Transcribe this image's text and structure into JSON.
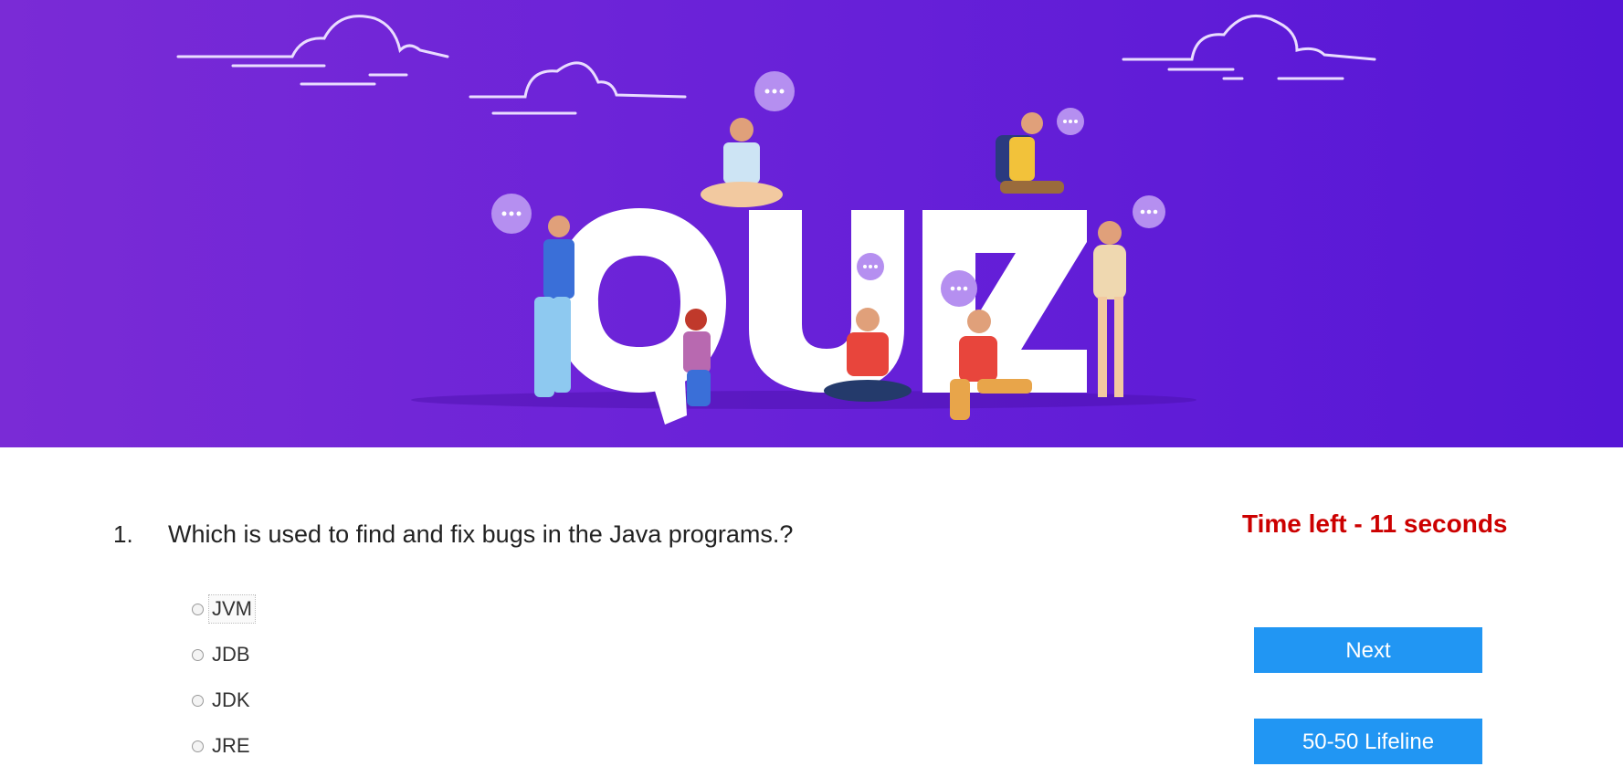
{
  "banner": {
    "title_letters": [
      "Q",
      "U",
      "I",
      "Z"
    ]
  },
  "question": {
    "number": "1.",
    "text": "Which is used to find and fix bugs in the Java programs.?"
  },
  "timer": {
    "prefix": "Time left - ",
    "seconds": "11",
    "suffix": " seconds"
  },
  "options": [
    {
      "label": "JVM"
    },
    {
      "label": "JDB"
    },
    {
      "label": "JDK"
    },
    {
      "label": "JRE"
    }
  ],
  "buttons": {
    "next_label": "Next",
    "lifeline_label": "50-50 Lifeline"
  },
  "colors": {
    "banner_start": "#7a2bd6",
    "banner_end": "#5616d6",
    "timer": "#cc0000",
    "button": "#2196f3"
  }
}
